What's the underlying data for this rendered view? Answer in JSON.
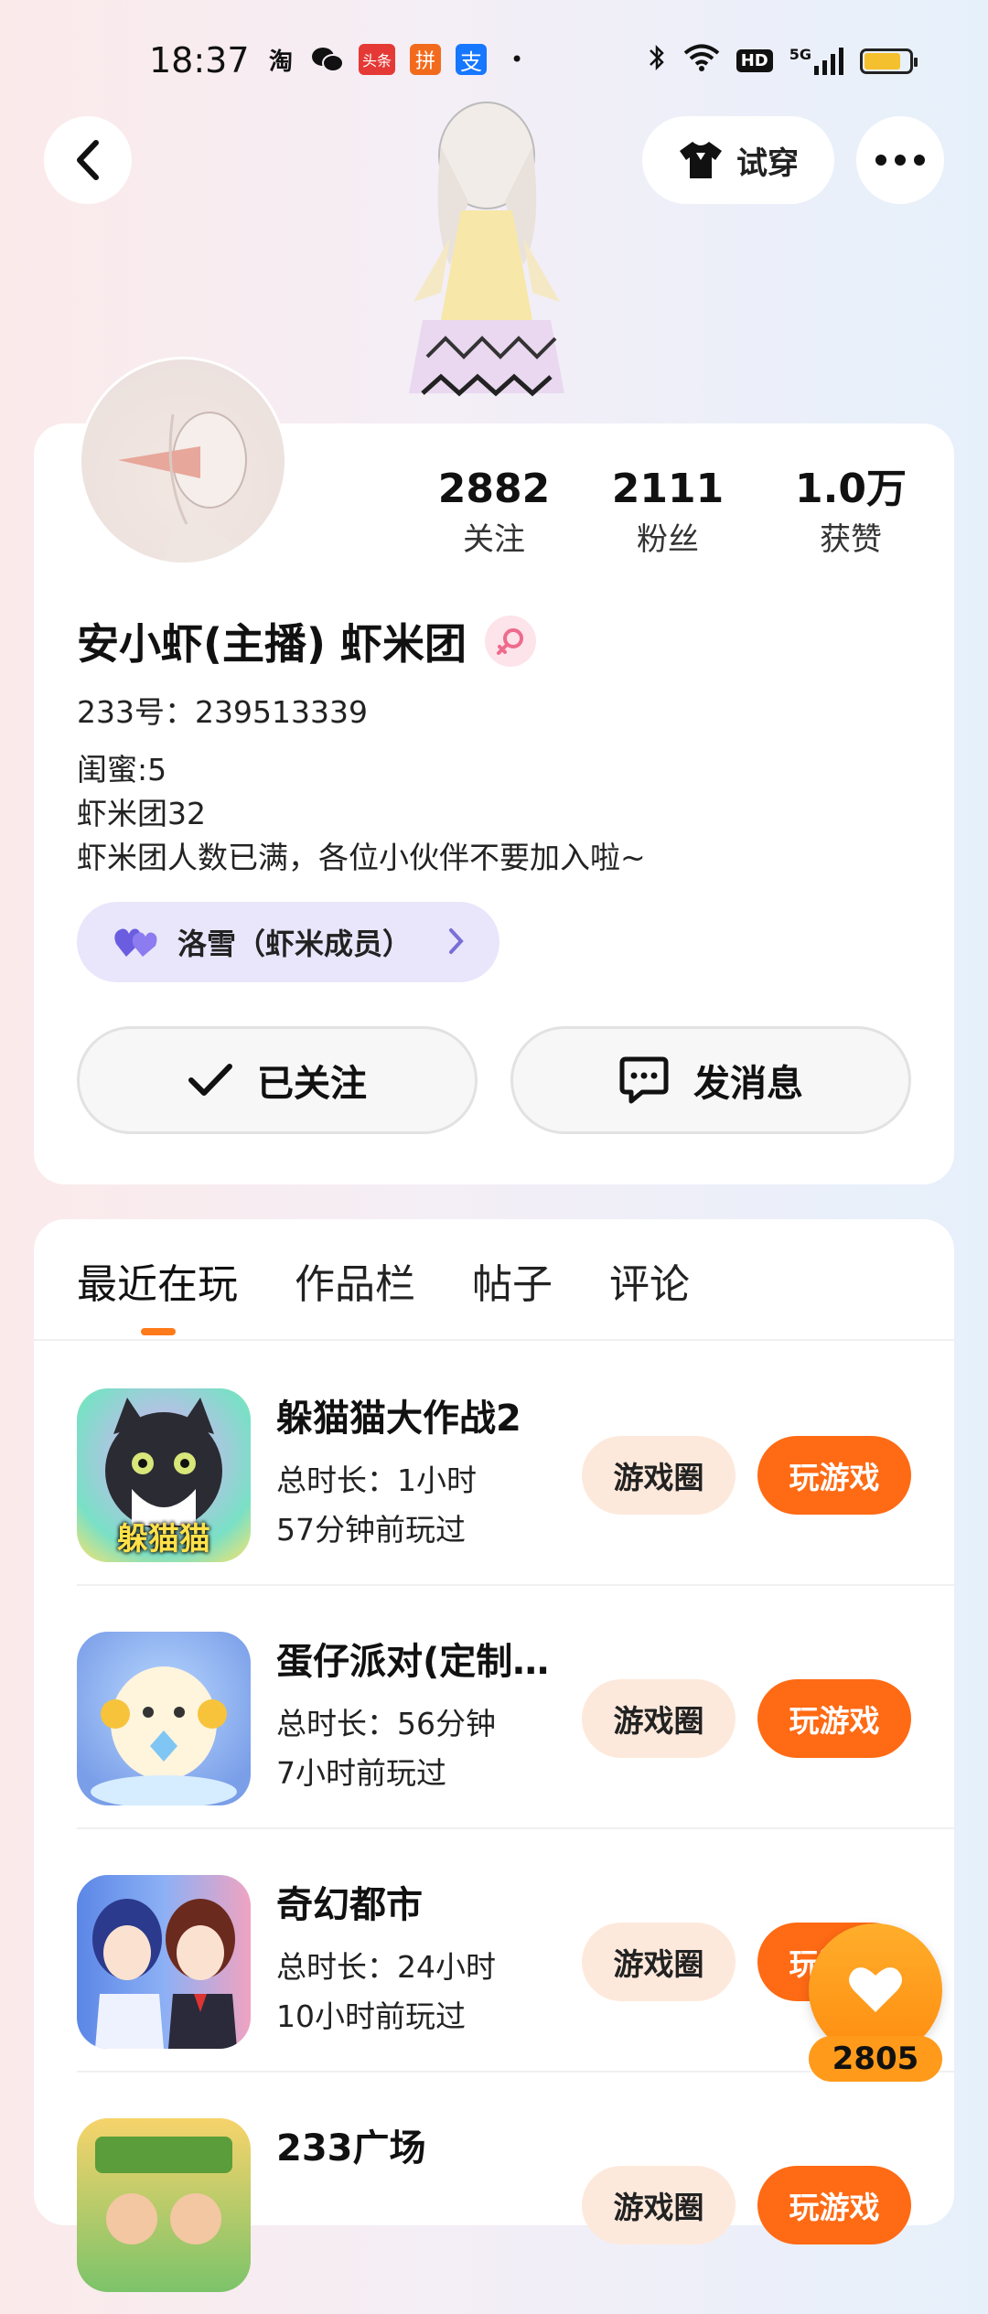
{
  "status_bar": {
    "time": "18:37",
    "app_icons": [
      "淘",
      "微信",
      "头条",
      "拼",
      "支"
    ],
    "network": "5G",
    "hd": "HD"
  },
  "header": {
    "try_on_label": "试穿"
  },
  "profile": {
    "name": "安小虾(主播) 虾米团",
    "uid_label": "233号：",
    "uid_value": "239513339",
    "bio_lines": [
      "闺蜜:5",
      "虾米团32",
      "虾米团人数已满，各位小伙伴不要加入啦~"
    ],
    "group_tag": "洛雪（虾米成员）",
    "stats": [
      {
        "value": "2882",
        "label": "关注"
      },
      {
        "value": "2111",
        "label": "粉丝"
      },
      {
        "value": "1.0万",
        "label": "获赞"
      }
    ],
    "followed_label": "已关注",
    "message_label": "发消息"
  },
  "tabs": [
    {
      "label": "最近在玩",
      "active": true
    },
    {
      "label": "作品栏",
      "active": false
    },
    {
      "label": "帖子",
      "active": false
    },
    {
      "label": "评论",
      "active": false
    }
  ],
  "games": [
    {
      "title": "躲猫猫大作战2",
      "duration": "总时长：1小时",
      "last_played": "57分钟前玩过",
      "icon_text": "躲猫猫",
      "circle_label": "游戏圈",
      "play_label": "玩游戏"
    },
    {
      "title": "蛋仔派对(定制…",
      "duration": "总时长：56分钟",
      "last_played": "7小时前玩过",
      "icon_text": "",
      "circle_label": "游戏圈",
      "play_label": "玩游戏"
    },
    {
      "title": "奇幻都市",
      "duration": "总时长：24小时",
      "last_played": "10小时前玩过",
      "icon_text": "",
      "circle_label": "游戏圈",
      "play_label": "玩游戏"
    },
    {
      "title": "233广场",
      "duration": "",
      "last_played": "",
      "icon_text": "",
      "circle_label": "游戏圈",
      "play_label": "玩游戏"
    }
  ],
  "like_fab": {
    "count": "2805"
  },
  "colors": {
    "accent": "#ff6a14",
    "circle_btn_bg": "#fde9dc",
    "tag_bg": "#e9e6fb"
  }
}
